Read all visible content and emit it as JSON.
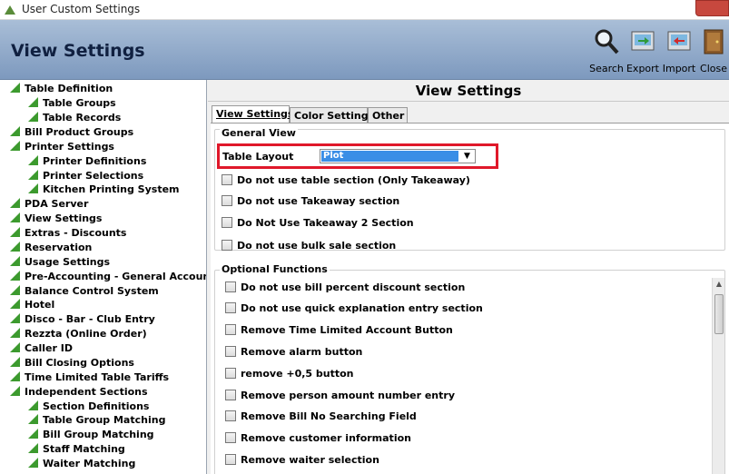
{
  "window": {
    "title": "User Custom Settings"
  },
  "header": {
    "title": "View Settings",
    "tools": [
      {
        "label": "Search",
        "icon": "search-icon"
      },
      {
        "label": "Export",
        "icon": "export-icon"
      },
      {
        "label": "Import",
        "icon": "import-icon"
      },
      {
        "label": "Close",
        "icon": "close-door-icon"
      }
    ]
  },
  "sidebar": {
    "items": [
      {
        "label": "Table Definition",
        "level": 0
      },
      {
        "label": "Table Groups",
        "level": 1
      },
      {
        "label": "Table Records",
        "level": 1
      },
      {
        "label": "Bill Product Groups",
        "level": 0
      },
      {
        "label": "Printer Settings",
        "level": 0
      },
      {
        "label": "Printer Definitions",
        "level": 1
      },
      {
        "label": "Printer Selections",
        "level": 1
      },
      {
        "label": "Kitchen Printing System",
        "level": 1
      },
      {
        "label": "PDA Server",
        "level": 0
      },
      {
        "label": "View Settings",
        "level": 0
      },
      {
        "label": "Extras - Discounts",
        "level": 0
      },
      {
        "label": "Reservation",
        "level": 0
      },
      {
        "label": "Usage Settings",
        "level": 0
      },
      {
        "label": "Pre-Accounting - General Accounting",
        "level": 0
      },
      {
        "label": "Balance Control System",
        "level": 0
      },
      {
        "label": "Hotel",
        "level": 0
      },
      {
        "label": "Disco - Bar - Club Entry",
        "level": 0
      },
      {
        "label": "Rezzta (Online Order)",
        "level": 0
      },
      {
        "label": "Caller ID",
        "level": 0
      },
      {
        "label": "Bill Closing Options",
        "level": 0
      },
      {
        "label": "Time Limited Table Tariffs",
        "level": 0
      },
      {
        "label": "Independent Sections",
        "level": 0
      },
      {
        "label": "Section Definitions",
        "level": 1
      },
      {
        "label": "Table Group Matching",
        "level": 1
      },
      {
        "label": "Bill Group Matching",
        "level": 1
      },
      {
        "label": "Staff Matching",
        "level": 1
      },
      {
        "label": "Waiter Matching",
        "level": 1
      }
    ]
  },
  "main": {
    "title": "View Settings",
    "tabs": [
      {
        "label": "View Settings",
        "active": true
      },
      {
        "label": "Color Settings",
        "active": false
      },
      {
        "label": "Other",
        "active": false
      }
    ],
    "general_view": {
      "label": "General View",
      "table_layout_label": "Table Layout",
      "table_layout_value": "Plot",
      "options": [
        "Do not use table section (Only Takeaway)",
        "Do not use Takeaway section",
        "Do Not Use Takeaway 2 Section",
        "Do not use bulk sale section"
      ]
    },
    "optional_functions": {
      "label": "Optional Functions",
      "options": [
        "Do not use bill percent discount section",
        "Do not use quick explanation entry section",
        "Remove Time Limited Account Button",
        "Remove alarm button",
        "remove +0,5 button",
        "Remove person amount number entry",
        "Remove Bill No Searching Field",
        "Remove customer information",
        "Remove waiter selection"
      ]
    }
  },
  "colors": {
    "header_bg": "#8ea7c8",
    "highlight": "#e0182a",
    "selection": "#3a8ee6",
    "tree_icon": "#3c9a2e"
  }
}
